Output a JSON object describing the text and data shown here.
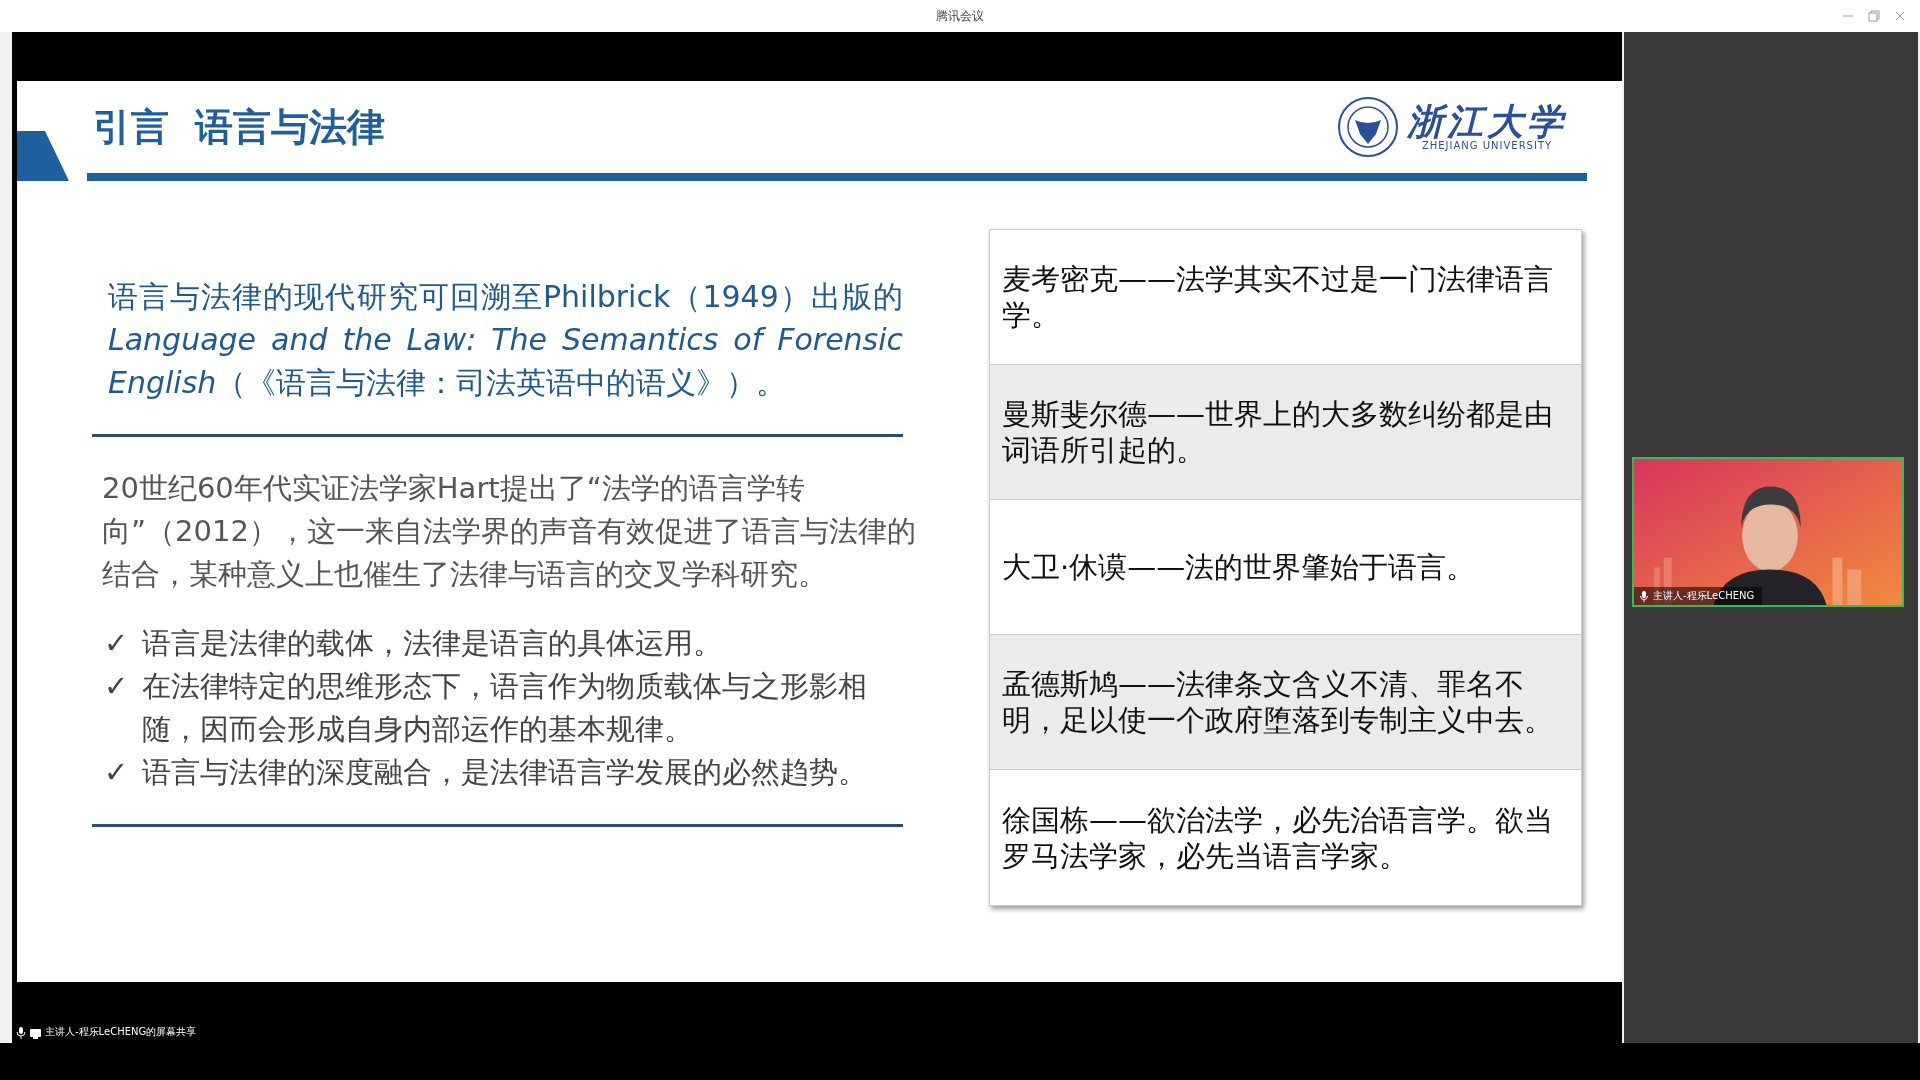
{
  "window": {
    "title": "腾讯会议"
  },
  "slide": {
    "title": "引言  语言与法律",
    "logo": {
      "name_cn": "浙江大学",
      "name_en": "ZHEJIANG UNIVERSITY"
    },
    "intro": {
      "lead": "语言与法律的现代研究可回溯至Philbrick（1949）出版的",
      "book_title": "Language and the Law: The Semantics of Forensic English",
      "tail": "（《语言与法律：司法英语中的语义》）。"
    },
    "paragraph": "20世纪60年代实证法学家Hart提出了“法学的语言学转向”（2012），这一来自法学界的声音有效促进了语言与法律的结合，某种意义上也催生了法律与语言的交叉学科研究。",
    "bullets": [
      {
        "mark": "✓",
        "text": "语言是法律的载体，法律是语言的具体运用。"
      },
      {
        "mark": "✓",
        "text": "在法律特定的思维形态下，语言作为物质载体与之形影相随，因而会形成自身内部运作的基本规律。"
      },
      {
        "mark": "✓",
        "text": "语言与法律的深度融合，是法律语言学发展的必然趋势。"
      }
    ],
    "quotes": [
      "麦考密克——法学其实不过是一门法律语言学。",
      "曼斯斐尔德——世界上的大多数纠纷都是由词语所引起的。",
      "大卫·休谟——法的世界肇始于语言。",
      "孟德斯鸠——法律条文含义不清、罪名不明，足以使一个政府堕落到专制主义中去。",
      "徐国栋——欲治法学，必先治语言学。欲当罗马法学家，必先当语言学家。"
    ]
  },
  "screen_share_label": "主讲人-程乐LeCHENG的屏幕共享",
  "video": {
    "kind": "picture",
    "speaker_label": "主讲人-程乐LeCHENG"
  }
}
